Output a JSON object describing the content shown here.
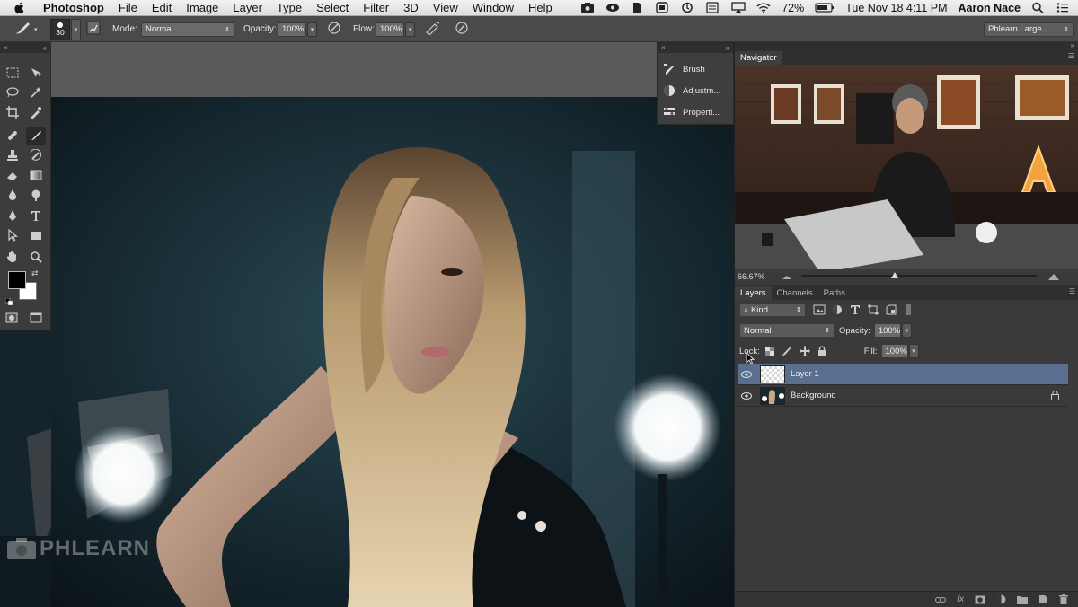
{
  "menubar": {
    "app": "Photoshop",
    "items": [
      "File",
      "Edit",
      "Image",
      "Layer",
      "Type",
      "Select",
      "Filter",
      "3D",
      "View",
      "Window",
      "Help"
    ],
    "battery": "72%",
    "datetime": "Tue Nov 18  4:11 PM",
    "user": "Aaron Nace"
  },
  "options": {
    "brush_size": "30",
    "mode_label": "Mode:",
    "mode_value": "Normal",
    "opacity_label": "Opacity:",
    "opacity_value": "100%",
    "flow_label": "Flow:",
    "flow_value": "100%",
    "workspace": "Phlearn Large"
  },
  "dock": {
    "items": [
      {
        "label": "Brush",
        "icon": "brush-presets-icon"
      },
      {
        "label": "Adjustm...",
        "icon": "adjustments-icon"
      },
      {
        "label": "Properti...",
        "icon": "properties-icon"
      }
    ]
  },
  "navigator": {
    "tab": "Navigator",
    "zoom": "66.67%",
    "zoom_slider_value": 0.4
  },
  "layers_panel": {
    "tabs": [
      "Layers",
      "Channels",
      "Paths"
    ],
    "filter_label": "Kind",
    "blend_mode": "Normal",
    "opacity_label": "Opacity:",
    "opacity_value": "100%",
    "lock_label": "Lock:",
    "fill_label": "Fill:",
    "fill_value": "100%",
    "layers": [
      {
        "name": "Layer 1",
        "selected": true,
        "locked": false
      },
      {
        "name": "Background",
        "selected": false,
        "locked": true
      }
    ]
  },
  "watermark": "PHLEARN",
  "colors": {
    "accent_selection": "#5a6f8f",
    "panel_bg": "#3a3a3a",
    "foreground_color": "#000000",
    "background_color": "#ffffff"
  }
}
